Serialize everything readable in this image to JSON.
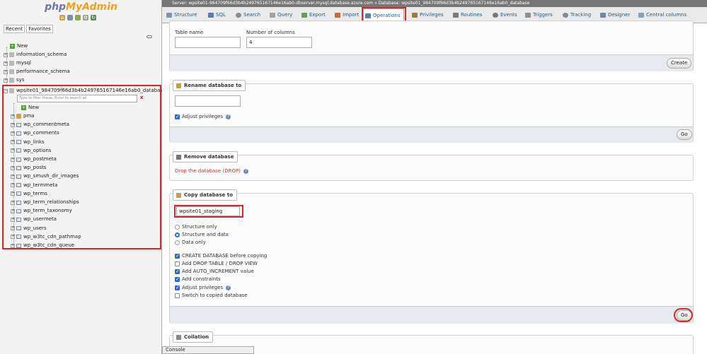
{
  "app": {
    "logo_php": "php",
    "logo_admin": "MyAdmin"
  },
  "nav": {
    "tabs": [
      "Recent",
      "Favorites"
    ],
    "new_label": "New",
    "databases": [
      "information_schema",
      "mysql",
      "performance_schema",
      "sys"
    ],
    "active_db": "wpsite01_984709f66d3b4b249765167146e16ab0_database",
    "filter_placeholder": "Type to filter these, Enter to search all",
    "filter_clear": "x",
    "db_new_label": "New",
    "tables": [
      "pma",
      "wp_commentmeta",
      "wp_comments",
      "wp_links",
      "wp_options",
      "wp_postmeta",
      "wp_posts",
      "wp_smush_dir_images",
      "wp_termmeta",
      "wp_terms",
      "wp_term_relationships",
      "wp_term_taxonomy",
      "wp_usermeta",
      "wp_users",
      "wp_w3tc_cdn_pathmap",
      "wp_w3tc_cdn_queue"
    ]
  },
  "breadcrumb": {
    "server": "Server: wpsite01-984709f66d3b4b249765167146e16ab0-dbserver.mysql.database.azure.com",
    "sep": "»",
    "database": "Database: wpsite01_984709f66d3b4b249765167146e16ab0_database"
  },
  "tabs": [
    "Structure",
    "SQL",
    "Search",
    "Query",
    "Export",
    "Import",
    "Operations",
    "Privileges",
    "Routines",
    "Events",
    "Triggers",
    "Tracking",
    "Designer",
    "Central columns"
  ],
  "create_table": {
    "name_label": "Table name",
    "cols_label": "Number of columns",
    "cols_value": "4",
    "button": "Create"
  },
  "rename": {
    "legend": "Rename database to",
    "value": "",
    "adjust_privileges": "Adjust privileges",
    "button": "Go"
  },
  "remove": {
    "legend": "Remove database",
    "drop_link": "Drop the database (DROP)"
  },
  "copy": {
    "legend": "Copy database to",
    "value": "wpsite01_staging",
    "radios": [
      "Structure only",
      "Structure and data",
      "Data only"
    ],
    "selected_radio": "Structure and data",
    "checkboxes": [
      {
        "label": "CREATE DATABASE before copying",
        "checked": true
      },
      {
        "label": "Add DROP TABLE / DROP VIEW",
        "checked": false
      },
      {
        "label": "Add AUTO_INCREMENT value",
        "checked": true
      },
      {
        "label": "Add constraints",
        "checked": true
      },
      {
        "label": "Adjust privileges",
        "checked": true
      },
      {
        "label": "Switch to copied database",
        "checked": false
      }
    ],
    "button": "Go"
  },
  "collation": {
    "legend": "Collation"
  },
  "console": {
    "label": "Console"
  },
  "colors": {
    "highlight": "#d62a2a",
    "link": "#235a81",
    "accent": "#2d6bc4"
  }
}
